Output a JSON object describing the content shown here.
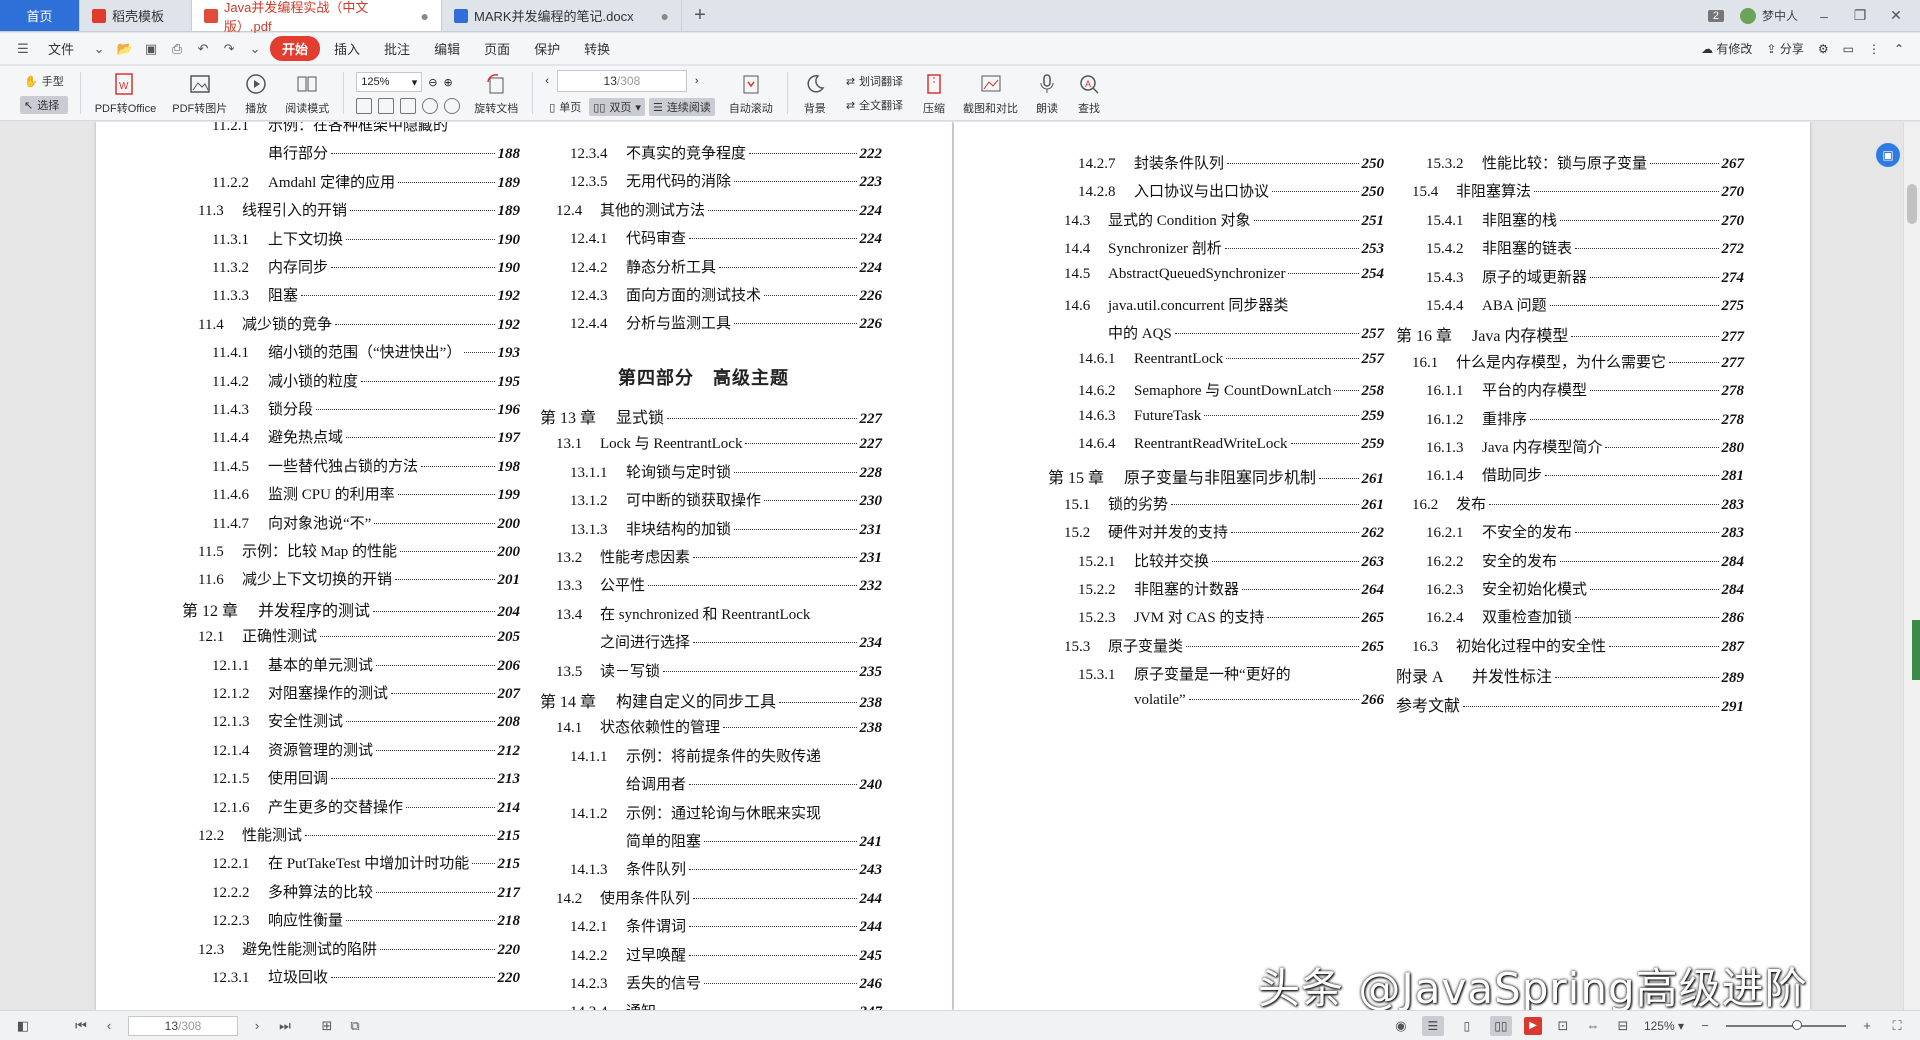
{
  "tabs": [
    {
      "label": "首页"
    },
    {
      "label": "稻壳模板"
    },
    {
      "label": "Java并发编程实战（中文版）.pdf"
    },
    {
      "label": "MARK并发编程的笔记.docx"
    }
  ],
  "window": {
    "badge": "2",
    "user": "梦中人"
  },
  "menu": {
    "file": "文件",
    "items": [
      "开始",
      "插入",
      "批注",
      "编辑",
      "页面",
      "保护",
      "转换"
    ],
    "right": {
      "changes": "有修改",
      "share": "分享"
    }
  },
  "ribbon": {
    "hand": "手型",
    "select": "选择",
    "pdf_office": "PDF转Office",
    "pdf_image": "PDF转图片",
    "play": "播放",
    "read_mode": "阅读模式",
    "zoom": "125%",
    "rotate": "旋转文档",
    "page_current": "13",
    "page_total": "/308",
    "single": "单页",
    "double": "双页",
    "continuous": "连续阅读",
    "autoscroll": "自动滚动",
    "background": "背景",
    "word_translate": "划词翻译",
    "full_translate": "全文翻译",
    "compress": "压缩",
    "screenshot": "截图和对比",
    "readaloud": "朗读",
    "find": "查找"
  },
  "toc_page1_col1": [
    {
      "num": "11.2.1",
      "title": "示例：在各种框架中隐藏的",
      "page": ""
    },
    {
      "num": "",
      "title": "串行部分",
      "page": "188"
    },
    {
      "num": "11.2.2",
      "title": "Amdahl 定律的应用",
      "page": "189"
    },
    {
      "num": "11.3",
      "title": "线程引入的开销",
      "page": "189"
    },
    {
      "num": "11.3.1",
      "title": "上下文切换",
      "page": "190"
    },
    {
      "num": "11.3.2",
      "title": "内存同步",
      "page": "190"
    },
    {
      "num": "11.3.3",
      "title": "阻塞",
      "page": "192"
    },
    {
      "num": "11.4",
      "title": "减少锁的竞争",
      "page": "192"
    },
    {
      "num": "11.4.1",
      "title": "缩小锁的范围（“快进快出”）",
      "page": "193"
    },
    {
      "num": "11.4.2",
      "title": "减小锁的粒度",
      "page": "195"
    },
    {
      "num": "11.4.3",
      "title": "锁分段",
      "page": "196"
    },
    {
      "num": "11.4.4",
      "title": "避免热点域",
      "page": "197"
    },
    {
      "num": "11.4.5",
      "title": "一些替代独占锁的方法",
      "page": "198"
    },
    {
      "num": "11.4.6",
      "title": "监测 CPU 的利用率",
      "page": "199"
    },
    {
      "num": "11.4.7",
      "title": "向对象池说“不”",
      "page": "200"
    },
    {
      "num": "11.5",
      "title": "示例：比较 Map 的性能",
      "page": "200"
    },
    {
      "num": "11.6",
      "title": "减少上下文切换的开销",
      "page": "201"
    },
    {
      "num": "第 12 章",
      "title": "并发程序的测试",
      "page": "204"
    },
    {
      "num": "12.1",
      "title": "正确性测试",
      "page": "205"
    },
    {
      "num": "12.1.1",
      "title": "基本的单元测试",
      "page": "206"
    },
    {
      "num": "12.1.2",
      "title": "对阻塞操作的测试",
      "page": "207"
    },
    {
      "num": "12.1.3",
      "title": "安全性测试",
      "page": "208"
    },
    {
      "num": "12.1.4",
      "title": "资源管理的测试",
      "page": "212"
    },
    {
      "num": "12.1.5",
      "title": "使用回调",
      "page": "213"
    },
    {
      "num": "12.1.6",
      "title": "产生更多的交替操作",
      "page": "214"
    },
    {
      "num": "12.2",
      "title": "性能测试",
      "page": "215"
    },
    {
      "num": "12.2.1",
      "title": "在 PutTakeTest 中增加计时功能",
      "page": "215"
    },
    {
      "num": "12.2.2",
      "title": "多种算法的比较",
      "page": "217"
    },
    {
      "num": "12.2.3",
      "title": "响应性衡量",
      "page": "218"
    },
    {
      "num": "12.3",
      "title": "避免性能测试的陷阱",
      "page": "220"
    },
    {
      "num": "12.3.1",
      "title": "垃圾回收",
      "page": "220"
    }
  ],
  "toc_page1_col2_a": [
    {
      "num": "12.3.4",
      "title": "不真实的竞争程度",
      "page": "222"
    },
    {
      "num": "12.3.5",
      "title": "无用代码的消除",
      "page": "223"
    },
    {
      "num": "12.4",
      "title": "其他的测试方法",
      "page": "224"
    },
    {
      "num": "12.4.1",
      "title": "代码审查",
      "page": "224"
    },
    {
      "num": "12.4.2",
      "title": "静态分析工具",
      "page": "224"
    },
    {
      "num": "12.4.3",
      "title": "面向方面的测试技术",
      "page": "226"
    },
    {
      "num": "12.4.4",
      "title": "分析与监测工具",
      "page": "226"
    }
  ],
  "part4_heading": "第四部分　高级主题",
  "toc_page1_col2_b": [
    {
      "num": "第 13 章",
      "title": "显式锁",
      "page": "227"
    },
    {
      "num": "13.1",
      "title": "Lock 与 ReentrantLock",
      "page": "227"
    },
    {
      "num": "13.1.1",
      "title": "轮询锁与定时锁",
      "page": "228"
    },
    {
      "num": "13.1.2",
      "title": "可中断的锁获取操作",
      "page": "230"
    },
    {
      "num": "13.1.3",
      "title": "非块结构的加锁",
      "page": "231"
    },
    {
      "num": "13.2",
      "title": "性能考虑因素",
      "page": "231"
    },
    {
      "num": "13.3",
      "title": "公平性",
      "page": "232"
    },
    {
      "num": "13.4",
      "title": "在 synchronized 和 ReentrantLock",
      "page": ""
    },
    {
      "num": "",
      "title": "之间进行选择",
      "page": "234"
    },
    {
      "num": "13.5",
      "title": "读－写锁",
      "page": "235"
    },
    {
      "num": "第 14 章",
      "title": "构建自定义的同步工具",
      "page": "238"
    },
    {
      "num": "14.1",
      "title": "状态依赖性的管理",
      "page": "238"
    },
    {
      "num": "14.1.1",
      "title": "示例：将前提条件的失败传递",
      "page": ""
    },
    {
      "num": "",
      "title": "给调用者",
      "page": "240"
    },
    {
      "num": "14.1.2",
      "title": "示例：通过轮询与休眠来实现",
      "page": ""
    },
    {
      "num": "",
      "title": "简单的阻塞",
      "page": "241"
    },
    {
      "num": "14.1.3",
      "title": "条件队列",
      "page": "243"
    },
    {
      "num": "14.2",
      "title": "使用条件队列",
      "page": "244"
    },
    {
      "num": "14.2.1",
      "title": "条件谓词",
      "page": "244"
    },
    {
      "num": "14.2.2",
      "title": "过早唤醒",
      "page": "245"
    },
    {
      "num": "14.2.3",
      "title": "丢失的信号",
      "page": "246"
    },
    {
      "num": "14.2.4",
      "title": "通知",
      "page": "247"
    }
  ],
  "toc_page2_col1": [
    {
      "num": "14.2.7",
      "title": "封装条件队列",
      "page": "250"
    },
    {
      "num": "14.2.8",
      "title": "入口协议与出口协议",
      "page": "250"
    },
    {
      "num": "14.3",
      "title": "显式的 Condition 对象",
      "page": "251"
    },
    {
      "num": "14.4",
      "title": "Synchronizer 剖析",
      "page": "253"
    },
    {
      "num": "14.5",
      "title": "AbstractQueuedSynchronizer",
      "page": "254"
    },
    {
      "num": "14.6",
      "title": "java.util.concurrent 同步器类",
      "page": ""
    },
    {
      "num": "",
      "title": "中的 AQS",
      "page": "257"
    },
    {
      "num": "14.6.1",
      "title": "ReentrantLock",
      "page": "257"
    },
    {
      "num": "14.6.2",
      "title": "Semaphore 与 CountDownLatch",
      "page": "258"
    },
    {
      "num": "14.6.3",
      "title": "FutureTask",
      "page": "259"
    },
    {
      "num": "14.6.4",
      "title": "ReentrantReadWriteLock",
      "page": "259"
    },
    {
      "num": "第 15 章",
      "title": "原子变量与非阻塞同步机制",
      "page": "261"
    },
    {
      "num": "15.1",
      "title": "锁的劣势",
      "page": "261"
    },
    {
      "num": "15.2",
      "title": "硬件对并发的支持",
      "page": "262"
    },
    {
      "num": "15.2.1",
      "title": "比较并交换",
      "page": "263"
    },
    {
      "num": "15.2.2",
      "title": "非阻塞的计数器",
      "page": "264"
    },
    {
      "num": "15.2.3",
      "title": "JVM 对 CAS 的支持",
      "page": "265"
    },
    {
      "num": "15.3",
      "title": "原子变量类",
      "page": "265"
    },
    {
      "num": "15.3.1",
      "title": "原子变量是一种“更好的",
      "page": ""
    },
    {
      "num": "",
      "title": "volatile”",
      "page": "266"
    }
  ],
  "toc_page2_col2": [
    {
      "num": "15.3.2",
      "title": "性能比较：锁与原子变量",
      "page": "267"
    },
    {
      "num": "15.4",
      "title": "非阻塞算法",
      "page": "270"
    },
    {
      "num": "15.4.1",
      "title": "非阻塞的栈",
      "page": "270"
    },
    {
      "num": "15.4.2",
      "title": "非阻塞的链表",
      "page": "272"
    },
    {
      "num": "15.4.3",
      "title": "原子的域更新器",
      "page": "274"
    },
    {
      "num": "15.4.4",
      "title": "ABA 问题",
      "page": "275"
    },
    {
      "num": "第 16 章",
      "title": "Java 内存模型",
      "page": "277"
    },
    {
      "num": "16.1",
      "title": "什么是内存模型，为什么需要它",
      "page": "277"
    },
    {
      "num": "16.1.1",
      "title": "平台的内存模型",
      "page": "278"
    },
    {
      "num": "16.1.2",
      "title": "重排序",
      "page": "278"
    },
    {
      "num": "16.1.3",
      "title": "Java 内存模型简介",
      "page": "280"
    },
    {
      "num": "16.1.4",
      "title": "借助同步",
      "page": "281"
    },
    {
      "num": "16.2",
      "title": "发布",
      "page": "283"
    },
    {
      "num": "16.2.1",
      "title": "不安全的发布",
      "page": "283"
    },
    {
      "num": "16.2.2",
      "title": "安全的发布",
      "page": "284"
    },
    {
      "num": "16.2.3",
      "title": "安全初始化模式",
      "page": "284"
    },
    {
      "num": "16.2.4",
      "title": "双重检查加锁",
      "page": "286"
    },
    {
      "num": "16.3",
      "title": "初始化过程中的安全性",
      "page": "287"
    },
    {
      "num": "附录 A",
      "title": "并发性标注",
      "page": "289"
    },
    {
      "num": "",
      "title": "参考文献",
      "page": "291"
    }
  ],
  "watermark": "头条 @JavaSpring高级进阶",
  "status": {
    "page_current": "13",
    "page_total": "/308",
    "zoom": "125%"
  }
}
